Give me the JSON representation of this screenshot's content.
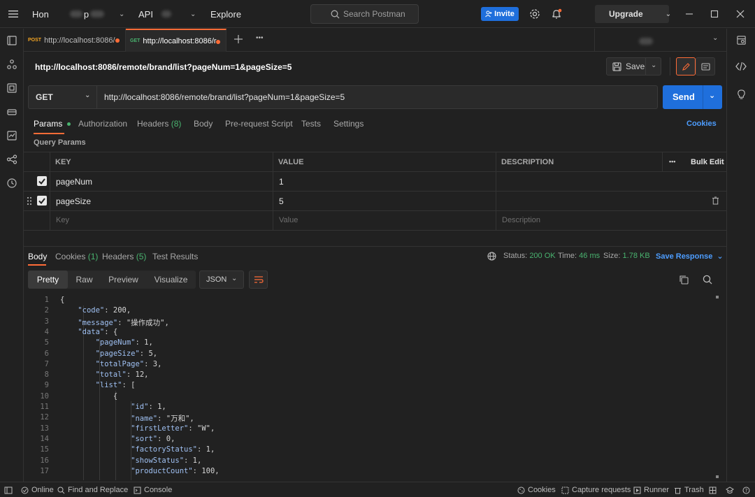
{
  "header": {
    "home_label": "Hon",
    "workspace_partial": "p",
    "api_label": "API",
    "explore_label": "Explore",
    "search_placeholder": "Search Postman",
    "invite_label": "Invite",
    "upgrade_label": "Upgrade"
  },
  "tabs": [
    {
      "method": "POST",
      "method_color": "#f5a623",
      "label": "http://localhost:8086/"
    },
    {
      "method": "GET",
      "method_color": "#49b36f",
      "label": "http://localhost:8086/r"
    }
  ],
  "request": {
    "title": "http://localhost:8086/remote/brand/list?pageNum=1&pageSize=5",
    "save_label": "Save",
    "method": "GET",
    "url": "http://localhost:8086/remote/brand/list?pageNum=1&pageSize=5",
    "send_label": "Send"
  },
  "request_tabs": {
    "params": "Params",
    "authorization": "Authorization",
    "headers": "Headers",
    "headers_count": "(8)",
    "body": "Body",
    "prerequest": "Pre-request Script",
    "tests": "Tests",
    "settings": "Settings",
    "cookies": "Cookies"
  },
  "params": {
    "section_label": "Query Params",
    "col_key": "KEY",
    "col_value": "VALUE",
    "col_description": "DESCRIPTION",
    "more": "•••",
    "bulk_edit": "Bulk Edit",
    "rows": [
      {
        "key": "pageNum",
        "value": "1"
      },
      {
        "key": "pageSize",
        "value": "5"
      }
    ],
    "placeholder_key": "Key",
    "placeholder_value": "Value",
    "placeholder_description": "Description"
  },
  "response": {
    "tab_body": "Body",
    "tab_cookies": "Cookies",
    "cookies_count": "(1)",
    "tab_headers": "Headers",
    "headers_count": "(5)",
    "tab_tests": "Test Results",
    "status_label": "Status:",
    "status_value": "200 OK",
    "time_label": "Time:",
    "time_value": "46 ms",
    "size_label": "Size:",
    "size_value": "1.78 KB",
    "save_response": "Save Response",
    "view_pretty": "Pretty",
    "view_raw": "Raw",
    "view_preview": "Preview",
    "view_visualize": "Visualize",
    "format": "JSON"
  },
  "code_lines": [
    {
      "n": "1",
      "t": "{"
    },
    {
      "n": "2",
      "t": "    \"code\": 200,"
    },
    {
      "n": "3",
      "t": "    \"message\": \"操作成功\","
    },
    {
      "n": "4",
      "t": "    \"data\": {"
    },
    {
      "n": "5",
      "t": "        \"pageNum\": 1,"
    },
    {
      "n": "6",
      "t": "        \"pageSize\": 5,"
    },
    {
      "n": "7",
      "t": "        \"totalPage\": 3,"
    },
    {
      "n": "8",
      "t": "        \"total\": 12,"
    },
    {
      "n": "9",
      "t": "        \"list\": ["
    },
    {
      "n": "10",
      "t": "            {"
    },
    {
      "n": "11",
      "t": "                \"id\": 1,"
    },
    {
      "n": "12",
      "t": "                \"name\": \"万和\","
    },
    {
      "n": "13",
      "t": "                \"firstLetter\": \"W\","
    },
    {
      "n": "14",
      "t": "                \"sort\": 0,"
    },
    {
      "n": "15",
      "t": "                \"factoryStatus\": 1,"
    },
    {
      "n": "16",
      "t": "                \"showStatus\": 1,"
    },
    {
      "n": "17",
      "t": "                \"productCount\": 100,"
    }
  ],
  "footer": {
    "online": "Online",
    "find_replace": "Find and Replace",
    "console": "Console",
    "cookies": "Cookies",
    "capture": "Capture requests",
    "runner": "Runner",
    "trash": "Trash"
  },
  "colors": {
    "accent": "#ff6c37",
    "primary": "#1f6fdc",
    "success": "#49b36f"
  }
}
